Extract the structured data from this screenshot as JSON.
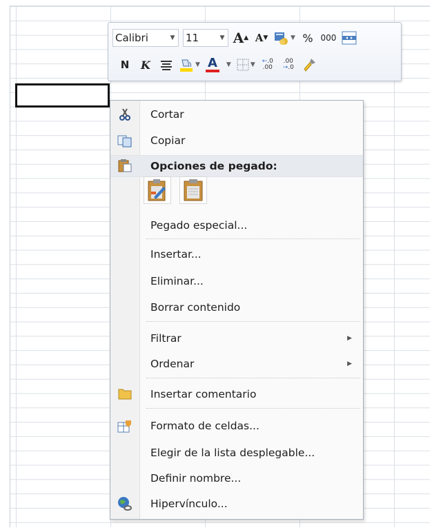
{
  "toolbar": {
    "font_name": "Calibri",
    "font_size": "11",
    "grow_font": "A",
    "shrink_font": "A",
    "percent": "%",
    "thousands": "000",
    "bold": "N",
    "italic": "K",
    "font_color_letter": "A",
    "inc_decimal": "←.0\n.00",
    "dec_decimal": ".00\n→.0",
    "colors": {
      "highlight": "#ffd800",
      "font": "#e02020"
    }
  },
  "menu": {
    "cut": "Cortar",
    "copy": "Copiar",
    "paste_options": "Opciones de pegado:",
    "paste_special": "Pegado especial...",
    "insert": "Insertar...",
    "delete": "Eliminar...",
    "clear": "Borrar contenido",
    "filter": "Filtrar",
    "sort": "Ordenar",
    "insert_comment": "Insertar comentario",
    "format_cells": "Formato de celdas...",
    "pick_list": "Elegir de la lista desplegable...",
    "define_name": "Definir nombre...",
    "hyperlink": "Hipervínculo..."
  }
}
